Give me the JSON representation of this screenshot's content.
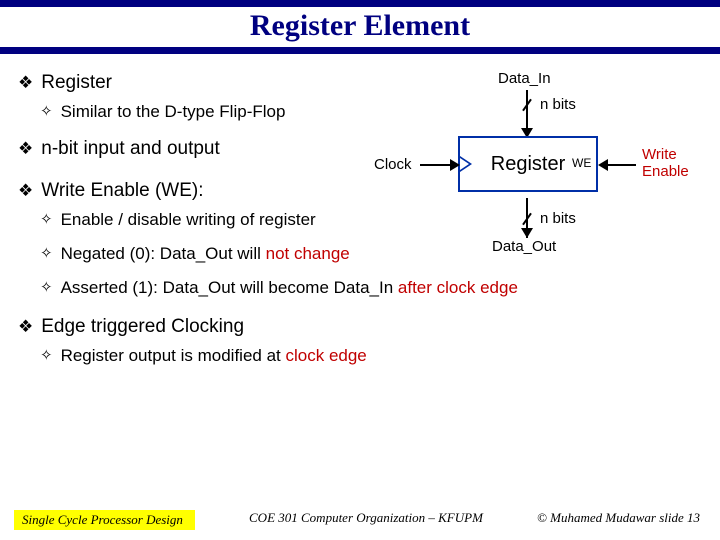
{
  "title": "Register Element",
  "bullets": {
    "b1": "Register",
    "b1a": "Similar to the D-type Flip-Flop",
    "b2": "n-bit input and output",
    "b3": "Write Enable (WE):",
    "b3a": "Enable / disable writing of register",
    "b3b_pre": "Negated  (0): Data_Out will ",
    "b3b_red": "not change",
    "b3c_pre": "Asserted (1): Data_Out will become Data_In ",
    "b3c_red": "after clock edge",
    "b4": "Edge triggered Clocking",
    "b4a_pre": "Register output is modified at ",
    "b4a_red": "clock edge"
  },
  "diagram": {
    "data_in": "Data_In",
    "data_out": "Data_Out",
    "n_bits": "n bits",
    "register": "Register",
    "we_small": "WE",
    "clock": "Clock",
    "write_enable_l1": "Write",
    "write_enable_l2": "Enable"
  },
  "footer": {
    "left": "Single Cycle Processor Design",
    "center": "COE 301 Computer Organization – KFUPM",
    "right": "© Muhamed Mudawar  slide 13"
  }
}
